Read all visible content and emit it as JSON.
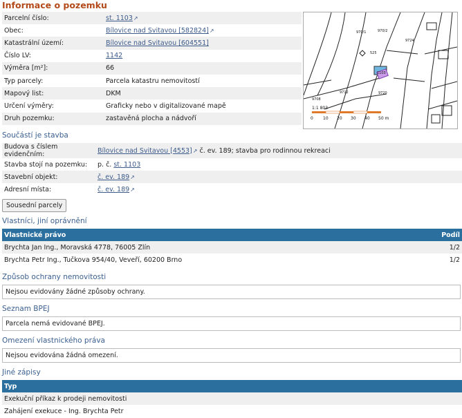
{
  "title": "Informace o pozemku",
  "parcel": {
    "rows": [
      {
        "label": "Parcelní číslo:",
        "value": "st. 1103",
        "link": true,
        "ext": true
      },
      {
        "label": "Obec:",
        "value": "Bílovice nad Svitavou [582824]",
        "link": true,
        "ext": true
      },
      {
        "label": "Katastrální území:",
        "value": "Bílovice nad Svitavou [604551]",
        "link": true,
        "ext": false
      },
      {
        "label": "Číslo LV:",
        "value": "1142",
        "link": true,
        "ext": false
      },
      {
        "label": "Výměra [m²]:",
        "value": "66",
        "link": false,
        "ext": false
      },
      {
        "label": "Typ parcely:",
        "value": "Parcela katastru nemovitostí",
        "link": false,
        "ext": false
      },
      {
        "label": "Mapový list:",
        "value": "DKM",
        "link": false,
        "ext": false
      },
      {
        "label": "Určení výměry:",
        "value": "Graficky nebo v digitalizované mapě",
        "link": false,
        "ext": false
      },
      {
        "label": "Druh pozemku:",
        "value": "zastavěná plocha a nádvoří",
        "link": false,
        "ext": false
      }
    ]
  },
  "map": {
    "labels": [
      "970/1",
      "9724",
      "525",
      "1103",
      "9712",
      "9720",
      "9708",
      "970/2"
    ],
    "scale_text": "1:1 803",
    "scale_ticks": [
      "0",
      "10",
      "20",
      "30",
      "40",
      "50 m"
    ],
    "accent": "#9b59d0"
  },
  "building": {
    "heading": "Součástí je stavba",
    "rows": [
      {
        "label": "Budova s číslem evidenčním:",
        "parts": [
          {
            "t": "Bílovice nad Svitavou [4553]",
            "link": true,
            "ext": true
          },
          {
            "t": " č. ev. 189; stavba pro rodinnou rekreaci",
            "link": false,
            "ext": false
          }
        ]
      },
      {
        "label": "Stavba stojí na pozemku:",
        "parts": [
          {
            "t": "p. č. ",
            "link": false,
            "ext": false
          },
          {
            "t": "st. 1103",
            "link": true,
            "ext": false
          }
        ]
      },
      {
        "label": "Stavební objekt:",
        "parts": [
          {
            "t": "č. ev. 189",
            "link": true,
            "ext": true
          }
        ]
      },
      {
        "label": "Adresní místa:",
        "parts": [
          {
            "t": "č. ev. 189",
            "link": true,
            "ext": true
          }
        ]
      }
    ]
  },
  "neighbor_button": "Sousední parcely",
  "owners": {
    "heading": "Vlastníci, jiní oprávnění",
    "col_right": "Vlastnické právo",
    "col_share": "Podíl",
    "rows": [
      {
        "name": "Brychta Jan Ing., Moravská 4778, 76005 Zlín",
        "share": "1/2"
      },
      {
        "name": "Brychta Petr Ing., Tučkova 954/40, Veveří, 60200 Brno",
        "share": "1/2"
      }
    ]
  },
  "protection": {
    "heading": "Způsob ochrany nemovitosti",
    "text": "Nejsou evidovány žádné způsoby ochrany."
  },
  "bpej": {
    "heading": "Seznam BPEJ",
    "text": "Parcela nemá evidované BPEJ."
  },
  "restrictions": {
    "heading": "Omezení vlastnického práva",
    "text": "Nejsou evidována žádná omezení."
  },
  "other": {
    "heading": "Jiné zápisy",
    "col_type": "Typ",
    "rows": [
      "Exekuční příkaz k prodeji nemovitosti",
      "Zahájení exekuce - Ing. Brychta Petr"
    ]
  },
  "colors": {
    "title": "#b24a1a",
    "section": "#3a5f8f",
    "header_bg": "#2a6f9e",
    "link": "#3c5a8a"
  }
}
